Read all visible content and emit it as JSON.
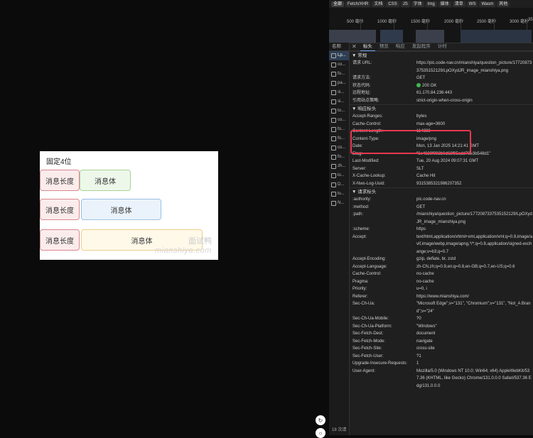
{
  "rendered_image": {
    "title": "固定4位",
    "rows": [
      {
        "len": "消息长度",
        "body": "消息体"
      },
      {
        "len": "消息长度",
        "body": "消息体"
      },
      {
        "len": "消息长度",
        "body": "消息体"
      }
    ],
    "watermark_cn": "面试鸭",
    "watermark_en": "mianshiya.com"
  },
  "side_buttons": [
    "↻",
    "○"
  ],
  "devtools": {
    "filters": [
      "全部",
      "Fetch/XHR",
      "文档",
      "CSS",
      "JS",
      "字体",
      "Img",
      "媒体",
      "清单",
      "WS",
      "Wasm",
      "其他"
    ],
    "timeline_ticks": [
      "500 毫秒",
      "1000 毫秒",
      "1500 毫秒",
      "2000 毫秒",
      "2500 毫秒",
      "3000 毫秒",
      "35"
    ],
    "name_header": "名称",
    "requests": [
      "Lp...",
      "co...",
      "fo...",
      "pa...",
      "si...",
      "si...",
      "to...",
      "co...",
      "fo...",
      "fo...",
      "co...",
      "fo...",
      "zh...",
      "lo...",
      "D...",
      "lo...",
      "N..."
    ],
    "footer": "18 次请",
    "tabs": [
      "标头",
      "预览",
      "响应",
      "发起程序",
      "计时"
    ],
    "general": {
      "title": "▼ 常规",
      "rows": [
        {
          "k": "请求 URL:",
          "v": "https://pic.code-nav.cn/mianshiya/question_picture/1772087337535152129/LpOXydJR_image_mianshiya.png"
        },
        {
          "k": "请求方法:",
          "v": "GET"
        },
        {
          "k": "状态代码:",
          "v": "200 OK"
        },
        {
          "k": "远程地址:",
          "v": "61.170.84.236:443"
        },
        {
          "k": "引用站点策略:",
          "v": "strict-origin-when-cross-origin"
        }
      ]
    },
    "response_headers": {
      "title": "▼ 响应标头",
      "rows": [
        {
          "k": "Accept-Ranges:",
          "v": "bytes"
        },
        {
          "k": "Cache-Control:",
          "v": "max-age=3600"
        },
        {
          "k": "Content-Length:",
          "v": "114388"
        },
        {
          "k": "Content-Type:",
          "v": "image/png"
        },
        {
          "k": "Date:",
          "v": "Mon, 13 Jan 2025 14:21:41 GMT"
        },
        {
          "k": "Etag:",
          "v": "\"6e4820f092b0d62f95add73e3b548d1\""
        },
        {
          "k": "Last-Modified:",
          "v": "Tue, 20 Aug 2024 09:07:31 GMT"
        },
        {
          "k": "Server:",
          "v": "SLT"
        },
        {
          "k": "X-Cache-Lookup:",
          "v": "Cache Hit"
        },
        {
          "k": "X-Nws-Log-Uuid:",
          "v": "9315385321986207352"
        }
      ]
    },
    "request_headers": {
      "title": "▼ 请求标头",
      "rows": [
        {
          "k": ":authority:",
          "v": "pic.code-nav.cn"
        },
        {
          "k": ":method:",
          "v": "GET"
        },
        {
          "k": ":path:",
          "v": "/mianshiya/question_picture/1772087337535152129/LpOXydJR_image_mianshiya.png"
        },
        {
          "k": ":scheme:",
          "v": "https"
        },
        {
          "k": "Accept:",
          "v": "text/html,application/xhtml+xml,application/xml;q=0.9,image/avif,image/webp,image/apng,*/*;q=0.8,application/signed-exchange;v=b3;q=0.7"
        },
        {
          "k": "Accept-Encoding:",
          "v": "gzip, deflate, br, zstd"
        },
        {
          "k": "Accept-Language:",
          "v": "zh-CN,zh;q=0.9,en;q=0.8,en-GB;q=0.7,en-US;q=0.6"
        },
        {
          "k": "Cache-Control:",
          "v": "no-cache"
        },
        {
          "k": "Pragma:",
          "v": "no-cache"
        },
        {
          "k": "Priority:",
          "v": "u=0, i"
        },
        {
          "k": "Referer:",
          "v": "https://www.mianshiya.com/"
        },
        {
          "k": "Sec-Ch-Ua:",
          "v": "\"Microsoft Edge\";v=\"131\", \"Chromium\";v=\"131\", \"Not_A Brand\";v=\"24\""
        },
        {
          "k": "Sec-Ch-Ua-Mobile:",
          "v": "?0"
        },
        {
          "k": "Sec-Ch-Ua-Platform:",
          "v": "\"Windows\""
        },
        {
          "k": "Sec-Fetch-Dest:",
          "v": "document"
        },
        {
          "k": "Sec-Fetch-Mode:",
          "v": "navigate"
        },
        {
          "k": "Sec-Fetch-Site:",
          "v": "cross-site"
        },
        {
          "k": "Sec-Fetch-User:",
          "v": "?1"
        },
        {
          "k": "Upgrade-Insecure-Requests:",
          "v": "1"
        },
        {
          "k": "User-Agent:",
          "v": "Mozilla/5.0 (Windows NT 10.0; Win64; x64) AppleWebKit/537.36 (KHTML, like Gecko) Chrome/131.0.0.0 Safari/537.36 Edg/131.0.0.0"
        }
      ]
    },
    "colors": {
      "highlight": "#e8384f",
      "status_ok": "#3fb950",
      "tab_accent": "#7aa6f7"
    }
  }
}
